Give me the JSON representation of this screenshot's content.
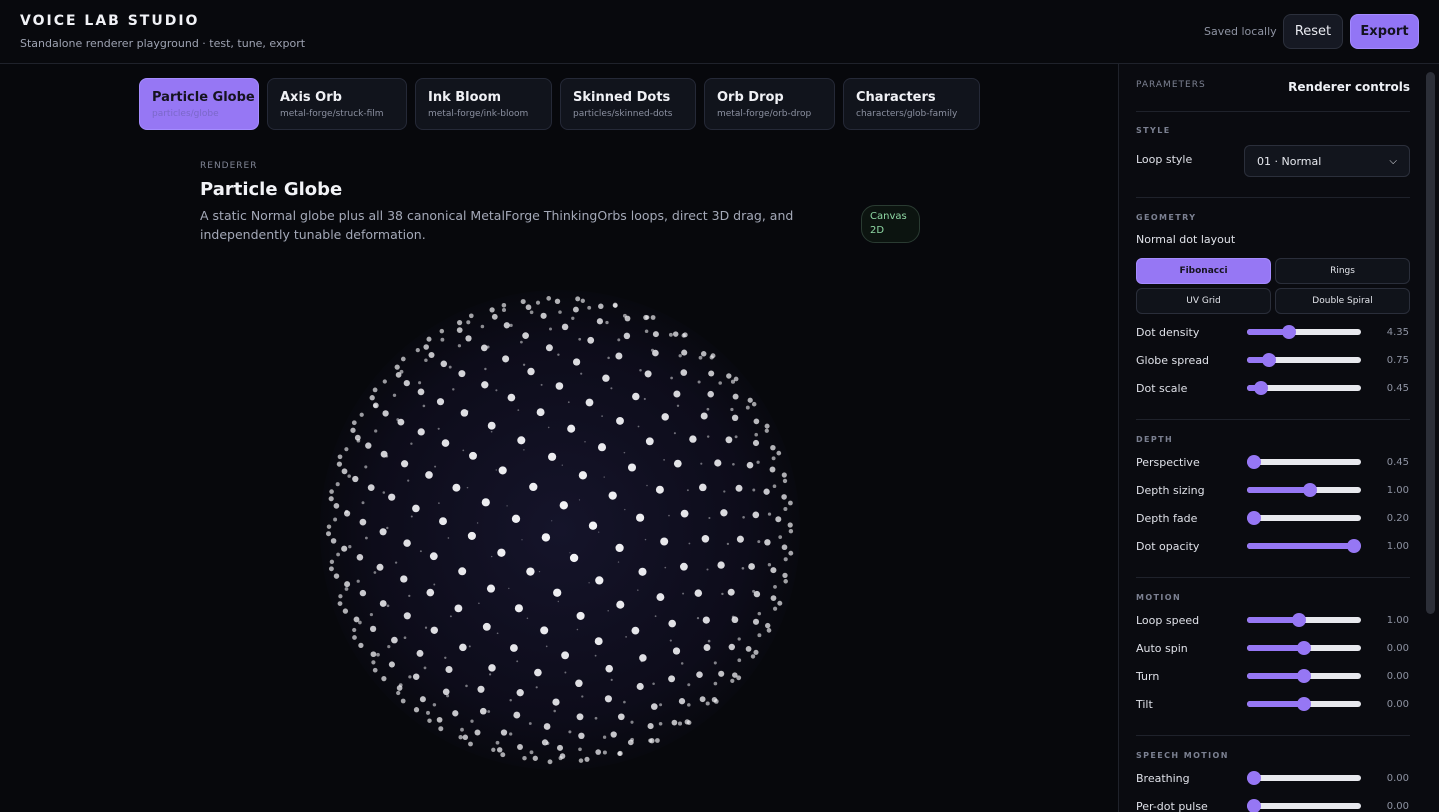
{
  "app": {
    "title": "VOICE LAB STUDIO",
    "subtitle": "Standalone renderer playground · test, tune, export",
    "saved_status": "Saved locally",
    "reset_label": "Reset",
    "export_label": "Export"
  },
  "tabs": [
    {
      "name": "Particle Globe",
      "path": "particles/globe",
      "active": true
    },
    {
      "name": "Axis Orb",
      "path": "metal-forge/struck-film",
      "active": false
    },
    {
      "name": "Ink Bloom",
      "path": "metal-forge/ink-bloom",
      "active": false
    },
    {
      "name": "Skinned Dots",
      "path": "particles/skinned-dots",
      "active": false
    },
    {
      "name": "Orb Drop",
      "path": "metal-forge/orb-drop",
      "active": false
    },
    {
      "name": "Characters",
      "path": "characters/glob-family",
      "active": false
    }
  ],
  "renderer": {
    "section_label": "RENDERER",
    "title": "Particle Globe",
    "description": "A static Normal globe plus all 38 canonical MetalForge ThinkingOrbs loops, direct 3D drag, and independently tunable deformation.",
    "badge": "Canvas 2D"
  },
  "panel": {
    "label": "PARAMETERS",
    "title": "Renderer controls",
    "style": {
      "heading": "STYLE",
      "loop_style_label": "Loop style",
      "loop_style_value": "01 · Normal"
    },
    "geometry": {
      "heading": "GEOMETRY",
      "layout_label": "Normal dot layout",
      "layouts": [
        "Fibonacci",
        "Rings",
        "UV Grid",
        "Double Spiral"
      ],
      "selected_layout": "Fibonacci",
      "sliders": [
        {
          "label": "Dot density",
          "value": "4.35",
          "fraction": 0.37
        },
        {
          "label": "Globe spread",
          "value": "0.75",
          "fraction": 0.19
        },
        {
          "label": "Dot scale",
          "value": "0.45",
          "fraction": 0.12
        }
      ]
    },
    "depth": {
      "heading": "DEPTH",
      "sliders": [
        {
          "label": "Perspective",
          "value": "0.45",
          "fraction": 0.06
        },
        {
          "label": "Depth sizing",
          "value": "1.00",
          "fraction": 0.55
        },
        {
          "label": "Depth fade",
          "value": "0.20",
          "fraction": 0.06
        },
        {
          "label": "Dot opacity",
          "value": "1.00",
          "fraction": 0.94
        }
      ]
    },
    "motion": {
      "heading": "MOTION",
      "sliders": [
        {
          "label": "Loop speed",
          "value": "1.00",
          "fraction": 0.46
        },
        {
          "label": "Auto spin",
          "value": "0.00",
          "fraction": 0.5
        },
        {
          "label": "Turn",
          "value": "0.00",
          "fraction": 0.5
        },
        {
          "label": "Tilt",
          "value": "0.00",
          "fraction": 0.5
        }
      ]
    },
    "speech_motion": {
      "heading": "SPEECH MOTION",
      "sliders": [
        {
          "label": "Breathing",
          "value": "0.00",
          "fraction": 0.06
        },
        {
          "label": "Per-dot pulse",
          "value": "0.00",
          "fraction": 0.06
        }
      ]
    }
  },
  "colors": {
    "accent": "#9677f4",
    "background": "#07080c",
    "dot": "#f2f2f5"
  }
}
